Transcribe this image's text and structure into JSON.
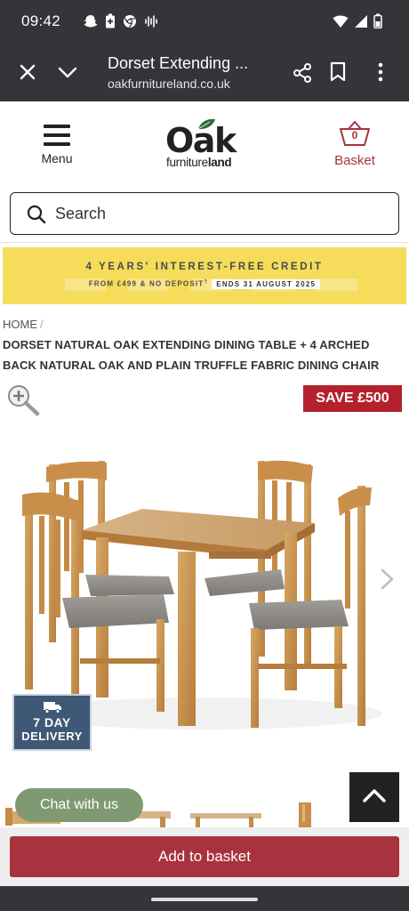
{
  "status_bar": {
    "time": "09:42",
    "icons_left": [
      "snapchat-icon",
      "battery-saver-icon",
      "chrome-icon",
      "voice-recorder-icon"
    ],
    "icons_right": [
      "wifi-icon",
      "signal-icon",
      "battery-icon"
    ]
  },
  "browser": {
    "page_title": "Dorset Extending ...",
    "url": "oakfurnitureland.co.uk"
  },
  "header": {
    "menu_label": "Menu",
    "logo_main": "Oak",
    "logo_sub_a": "furniture",
    "logo_sub_b": "land",
    "basket_count": "0",
    "basket_label": "Basket"
  },
  "search": {
    "placeholder": "Search"
  },
  "promo": {
    "main": "4 YEARS' INTEREST-FREE CREDIT",
    "sub": "FROM £499 & NO DEPOSIT",
    "sub_mark": "†",
    "ends": "ENDS 31 AUGUST 2025"
  },
  "breadcrumb": {
    "home": "HOME",
    "separator": "/"
  },
  "product": {
    "title": "DORSET NATURAL OAK EXTENDING DINING TABLE + 4 ARCHED BACK NATURAL OAK AND PLAIN TRUFFLE FABRIC DINING CHAIR",
    "save_badge": "SAVE £500",
    "delivery_line1": "7 DAY",
    "delivery_line2": "DELIVERY"
  },
  "actions": {
    "chat_label": "Chat with us",
    "add_to_basket": "Add to basket"
  },
  "colors": {
    "status_bar_bg": "#333539",
    "brand_red": "#a8323e",
    "promo_yellow": "#f5dc5a",
    "save_red": "#b3212d",
    "delivery_blue": "#3f5875",
    "chat_green": "#7f9a72"
  }
}
